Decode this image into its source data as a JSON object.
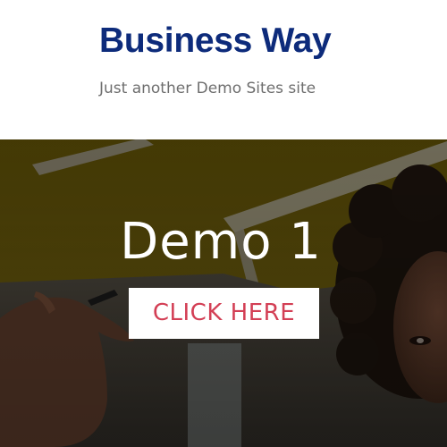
{
  "header": {
    "site_title": "Business Way",
    "tagline": "Just another Demo Sites site"
  },
  "hero": {
    "heading": "Demo 1",
    "cta_label": "CLICK HERE",
    "background": "photo-woman-holding-pen-office"
  },
  "colors": {
    "title": "#0d2b7b",
    "tagline": "#6e6e6e",
    "cta_text": "#d33f55",
    "cta_background": "#ffffff",
    "hero_overlay": "#3a3320",
    "hero_yellow_wall": "#6b5a08"
  }
}
